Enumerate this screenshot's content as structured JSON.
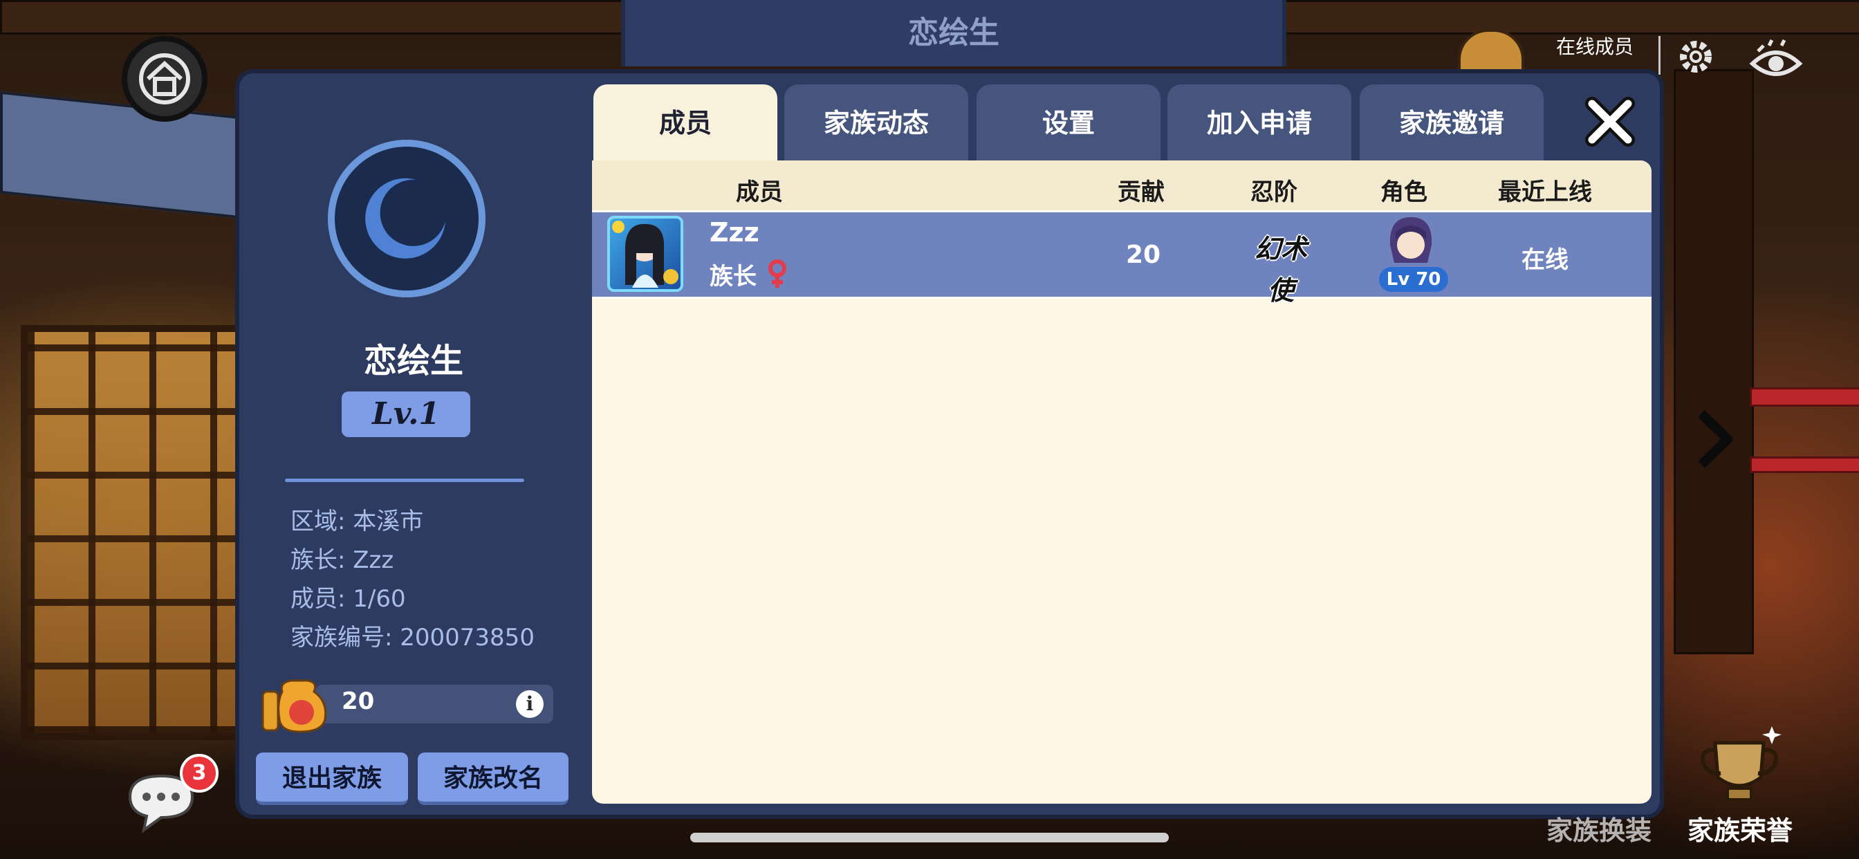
{
  "top": {
    "title": "恋绘生",
    "online_label": "在线成员"
  },
  "family": {
    "name": "恋绘生",
    "level": "Lv.1",
    "region": "区域: 本溪市",
    "leader": "族长: Zzz",
    "members": "成员: 1/60",
    "id": "家族编号: 200073850",
    "fund": "20",
    "fund_info": "i"
  },
  "buttons": {
    "leave": "退出家族",
    "rename": "家族改名"
  },
  "tabs": [
    "成员",
    "家族动态",
    "设置",
    "加入申请",
    "家族邀请"
  ],
  "active_tab": "成员",
  "table": {
    "headers": [
      "成员",
      "贡献",
      "忍阶",
      "角色",
      "最近上线"
    ],
    "rows": [
      {
        "name": "Zzz",
        "title": "族长",
        "contribution": "20",
        "rank": "幻术使",
        "role_level": "Lv 70",
        "last_online": "在线"
      }
    ]
  },
  "chat": {
    "badge": "3"
  },
  "bottom": {
    "left_label": "家族换装",
    "right_label": "家族荣誉"
  },
  "colors": {
    "panel": "#2e3b60",
    "accent": "#7f9de6",
    "row_highlight": "#6f84bf",
    "table_bg": "#fcf6e2"
  },
  "icons": [
    "home-icon",
    "settings-gear-icon",
    "eye-icon",
    "close-icon",
    "chat-icon",
    "fund-bag-icon",
    "info-icon",
    "female-icon",
    "next-arrow-icon",
    "honor-trophy-icon"
  ]
}
